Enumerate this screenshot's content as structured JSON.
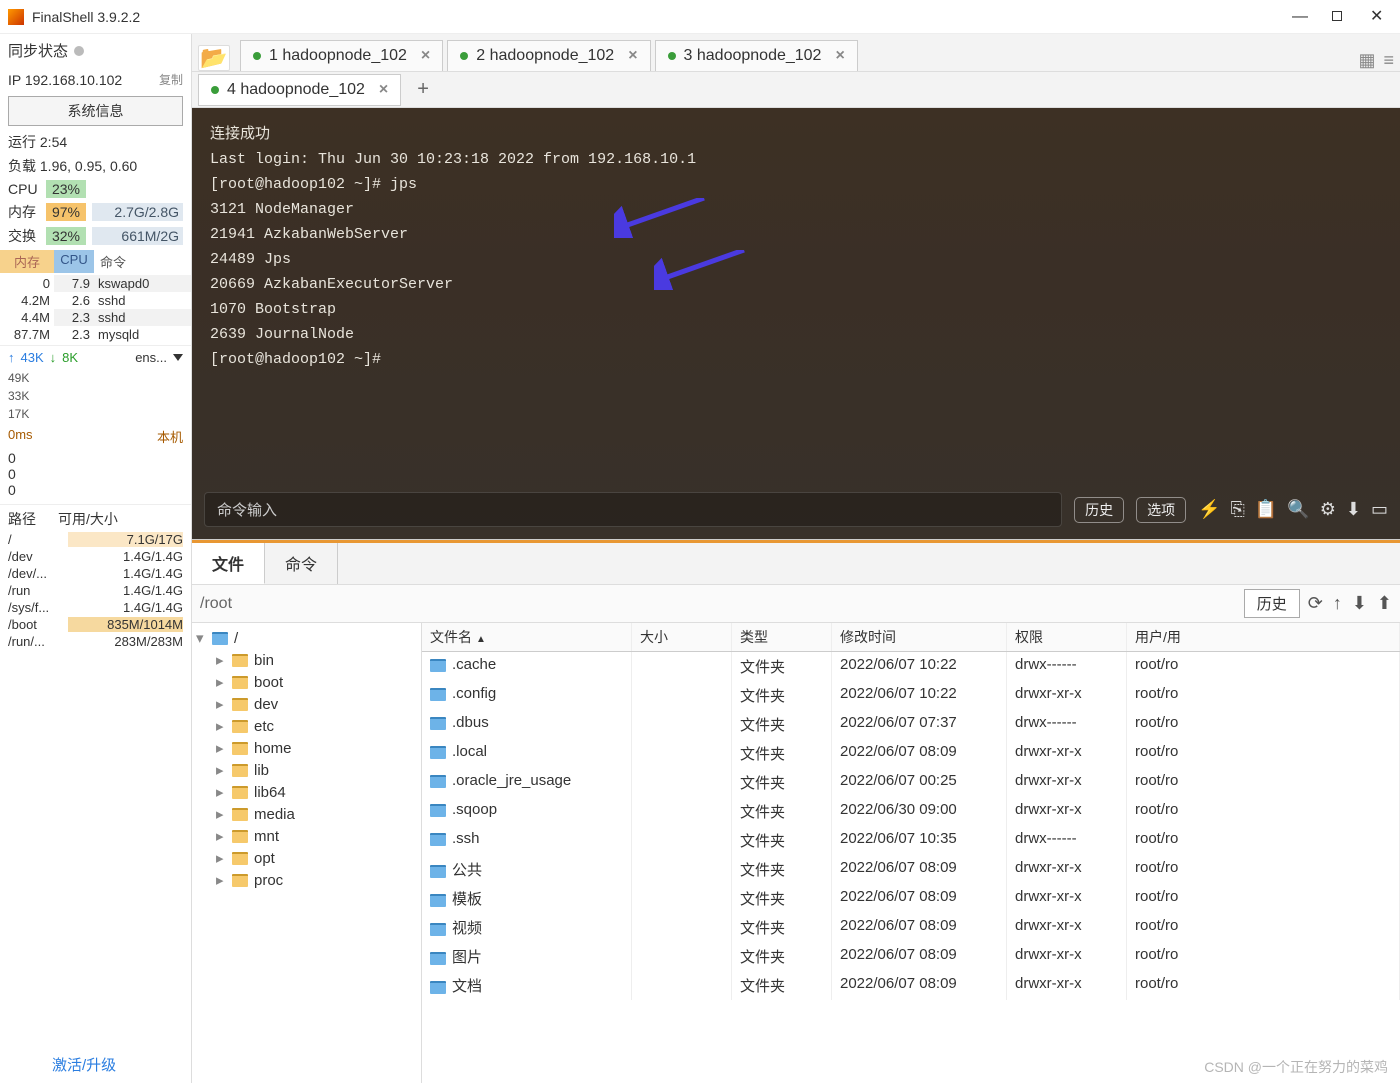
{
  "app": {
    "title": "FinalShell 3.9.2.2"
  },
  "sidebar": {
    "sync": "同步状态",
    "ip": "IP 192.168.10.102",
    "copy": "复制",
    "sysinfo": "系统信息",
    "runtime": "运行 2:54",
    "load": "负载 1.96, 0.95, 0.60",
    "cpu": {
      "label": "CPU",
      "pct": "23%"
    },
    "mem": {
      "label": "内存",
      "pct": "97%",
      "val": "2.7G/2.8G"
    },
    "swap": {
      "label": "交换",
      "pct": "32%",
      "val": "661M/2G"
    },
    "proc_head": {
      "mem": "内存",
      "cpu": "CPU",
      "cmd": "命令"
    },
    "procs": [
      {
        "mem": "0",
        "cpu": "7.9",
        "cmd": "kswapd0"
      },
      {
        "mem": "4.2M",
        "cpu": "2.6",
        "cmd": "sshd"
      },
      {
        "mem": "4.4M",
        "cpu": "2.3",
        "cmd": "sshd"
      },
      {
        "mem": "87.7M",
        "cpu": "2.3",
        "cmd": "mysqld"
      }
    ],
    "net": {
      "up": "43K",
      "down": "8K",
      "iface": "ens..."
    },
    "yticks": [
      "49K",
      "33K",
      "17K"
    ],
    "ping": "0ms",
    "host": "本机",
    "disk_head": {
      "path": "路径",
      "avail": "可用/大小"
    },
    "disks": [
      {
        "p": "/",
        "v": "7.1G/17G",
        "cls": "h1"
      },
      {
        "p": "/dev",
        "v": "1.4G/1.4G"
      },
      {
        "p": "/dev/...",
        "v": "1.4G/1.4G"
      },
      {
        "p": "/run",
        "v": "1.4G/1.4G"
      },
      {
        "p": "/sys/f...",
        "v": "1.4G/1.4G"
      },
      {
        "p": "/boot",
        "v": "835M/1014M",
        "cls": "h2"
      },
      {
        "p": "/run/...",
        "v": "283M/283M"
      }
    ],
    "activate": "激活/升级"
  },
  "tabs": [
    {
      "label": "1 hadoopnode_102"
    },
    {
      "label": "2 hadoopnode_102"
    },
    {
      "label": "3 hadoopnode_102"
    }
  ],
  "active_tab": {
    "label": "4 hadoopnode_102"
  },
  "terminal": {
    "lines": [
      "连接成功",
      "Last login: Thu Jun 30 10:23:18 2022 from 192.168.10.1",
      "[root@hadoop102 ~]# jps",
      "3121 NodeManager",
      "21941 AzkabanWebServer",
      "24489 Jps",
      "20669 AzkabanExecutorServer",
      "1070 Bootstrap",
      "2639 JournalNode",
      "[root@hadoop102 ~]# "
    ],
    "cmd_placeholder": "命令输入",
    "history": "历史",
    "options": "选项"
  },
  "file": {
    "tab_files": "文件",
    "tab_cmds": "命令",
    "path": "/root",
    "history": "历史",
    "tree_root": "/",
    "tree": [
      "bin",
      "boot",
      "dev",
      "etc",
      "home",
      "lib",
      "lib64",
      "media",
      "mnt",
      "opt",
      "proc"
    ],
    "cols": {
      "name": "文件名",
      "size": "大小",
      "type": "类型",
      "time": "修改时间",
      "perm": "权限",
      "owner": "用户/用"
    },
    "rows": [
      {
        "n": ".cache",
        "t": "文件夹",
        "m": "2022/06/07 10:22",
        "p": "drwx------",
        "o": "root/ro"
      },
      {
        "n": ".config",
        "t": "文件夹",
        "m": "2022/06/07 10:22",
        "p": "drwxr-xr-x",
        "o": "root/ro"
      },
      {
        "n": ".dbus",
        "t": "文件夹",
        "m": "2022/06/07 07:37",
        "p": "drwx------",
        "o": "root/ro"
      },
      {
        "n": ".local",
        "t": "文件夹",
        "m": "2022/06/07 08:09",
        "p": "drwxr-xr-x",
        "o": "root/ro"
      },
      {
        "n": ".oracle_jre_usage",
        "t": "文件夹",
        "m": "2022/06/07 00:25",
        "p": "drwxr-xr-x",
        "o": "root/ro"
      },
      {
        "n": ".sqoop",
        "t": "文件夹",
        "m": "2022/06/30 09:00",
        "p": "drwxr-xr-x",
        "o": "root/ro"
      },
      {
        "n": ".ssh",
        "t": "文件夹",
        "m": "2022/06/07 10:35",
        "p": "drwx------",
        "o": "root/ro"
      },
      {
        "n": "公共",
        "t": "文件夹",
        "m": "2022/06/07 08:09",
        "p": "drwxr-xr-x",
        "o": "root/ro"
      },
      {
        "n": "模板",
        "t": "文件夹",
        "m": "2022/06/07 08:09",
        "p": "drwxr-xr-x",
        "o": "root/ro"
      },
      {
        "n": "视频",
        "t": "文件夹",
        "m": "2022/06/07 08:09",
        "p": "drwxr-xr-x",
        "o": "root/ro"
      },
      {
        "n": "图片",
        "t": "文件夹",
        "m": "2022/06/07 08:09",
        "p": "drwxr-xr-x",
        "o": "root/ro"
      },
      {
        "n": "文档",
        "t": "文件夹",
        "m": "2022/06/07 08:09",
        "p": "drwxr-xr-x",
        "o": "root/ro"
      }
    ]
  },
  "watermark": "CSDN @一个正在努力的菜鸡"
}
